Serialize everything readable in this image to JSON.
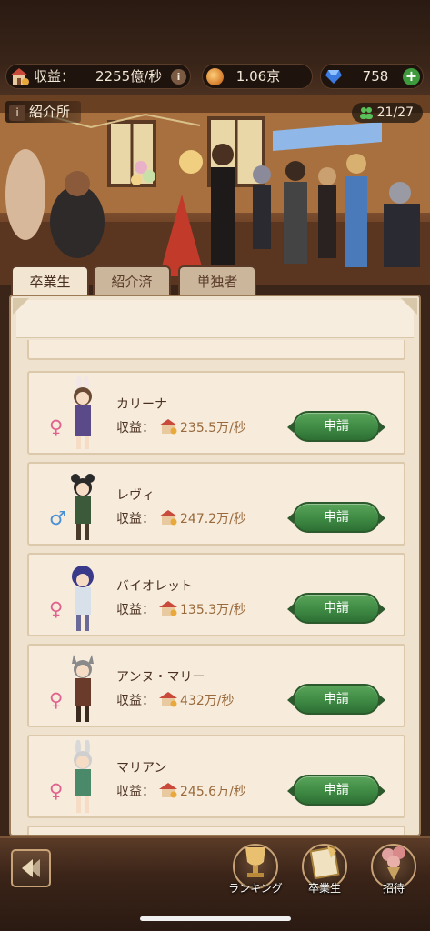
{
  "resources": {
    "income_label": "収益：",
    "income_value": "2255億/秒",
    "coins": "1.06京",
    "gems": "758"
  },
  "banner": {
    "title": "紹介所",
    "member_count": "21/27"
  },
  "tabs": [
    {
      "label": "卒業生",
      "active": true
    },
    {
      "label": "紹介済",
      "active": false
    },
    {
      "label": "単独者",
      "active": false
    }
  ],
  "list": {
    "income_label": "収益：",
    "apply_label": "申請",
    "items": [
      {
        "name": "カリーナ",
        "income": "235.5万/秒",
        "gender": "♀"
      },
      {
        "name": "レヴィ",
        "income": "247.2万/秒",
        "gender": "♂"
      },
      {
        "name": "バイオレット",
        "income": "135.3万/秒",
        "gender": "♀"
      },
      {
        "name": "アンヌ・マリー",
        "income": "432万/秒",
        "gender": "♀"
      },
      {
        "name": "マリアン",
        "income": "245.6万/秒",
        "gender": "♀"
      }
    ],
    "partial_top_gender": "♂"
  },
  "nav": {
    "ranking": "ランキング",
    "graduates": "卒業生",
    "invite": "招待"
  },
  "colors": {
    "accent_green": "#3e8a44",
    "female": "#e0628e",
    "male": "#4a8fd6"
  }
}
